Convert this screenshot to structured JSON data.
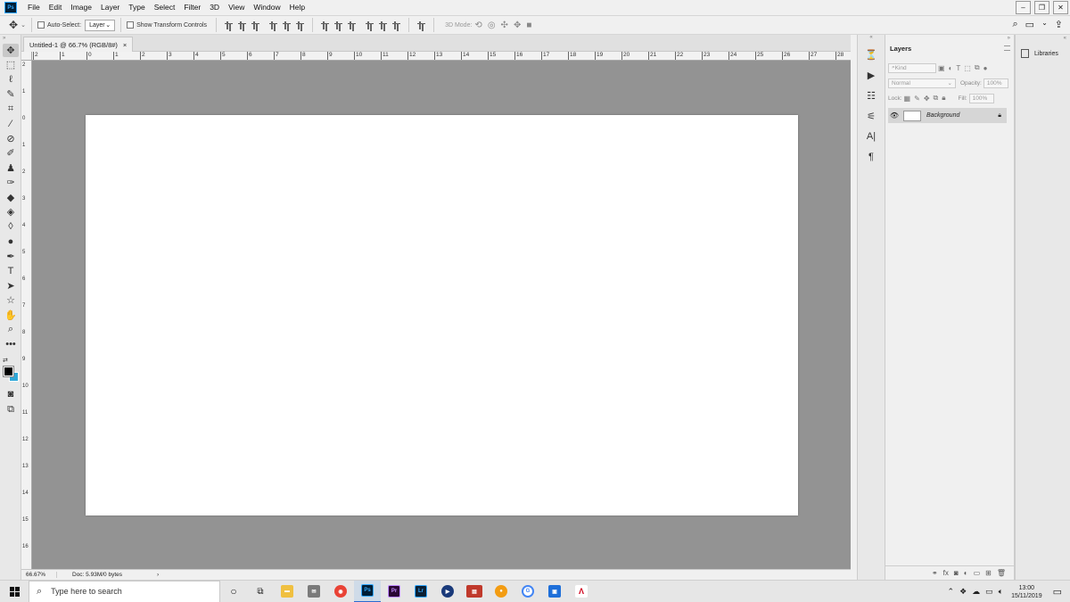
{
  "app": {
    "logo": "Ps"
  },
  "menu": [
    "File",
    "Edit",
    "Image",
    "Layer",
    "Type",
    "Select",
    "Filter",
    "3D",
    "View",
    "Window",
    "Help"
  ],
  "window_controls": [
    "–",
    "❐",
    "✕"
  ],
  "options": {
    "auto_select_label": "Auto-Select:",
    "auto_select_value": "Layer",
    "transform_label": "Show Transform Controls",
    "mode_3d_label": "3D Mode:"
  },
  "document": {
    "tab_title": "Untitled-1 @ 66.7% (RGB/8#)",
    "tab_close": "×",
    "zoom": "66.67%",
    "doc_info": "Doc: 5.93M/0 bytes",
    "status_arrow": "›",
    "ruler_h_labels": [
      "2",
      "1",
      "0",
      "1",
      "2",
      "3",
      "4",
      "5",
      "6",
      "7",
      "8",
      "9",
      "10",
      "11",
      "12",
      "13",
      "14",
      "15",
      "16",
      "17",
      "18",
      "19",
      "20",
      "21",
      "22",
      "23",
      "24",
      "25",
      "26",
      "27",
      "28"
    ],
    "ruler_v_labels": [
      "2",
      "1",
      "0",
      "1",
      "2",
      "3",
      "4",
      "5",
      "6",
      "7",
      "8",
      "9",
      "10",
      "11",
      "12",
      "13",
      "14",
      "15",
      "16"
    ]
  },
  "layers": {
    "panel_title": "Layers",
    "filter_placeholder": "Kind",
    "blend_mode": "Normal",
    "opacity_label": "Opacity:",
    "opacity_value": "100%",
    "lock_label": "Lock:",
    "fill_label": "Fill:",
    "fill_value": "100%",
    "items": [
      {
        "name": "Background",
        "visible": true,
        "locked": true
      }
    ]
  },
  "libraries": {
    "label": "Libraries"
  },
  "taskbar": {
    "search_placeholder": "Type here to search",
    "apps": [
      "cortana",
      "task-view",
      "file-explorer",
      "mail",
      "chrome",
      "photoshop",
      "premiere",
      "lightroom",
      "video-player",
      "news",
      "app-orange",
      "google",
      "store",
      "adobe-acrobat"
    ],
    "premiere_label": "Pr",
    "photoshop_label": "Ps",
    "lightroom_label": "Lr",
    "time": "13:00",
    "date": "15/11/2019"
  }
}
